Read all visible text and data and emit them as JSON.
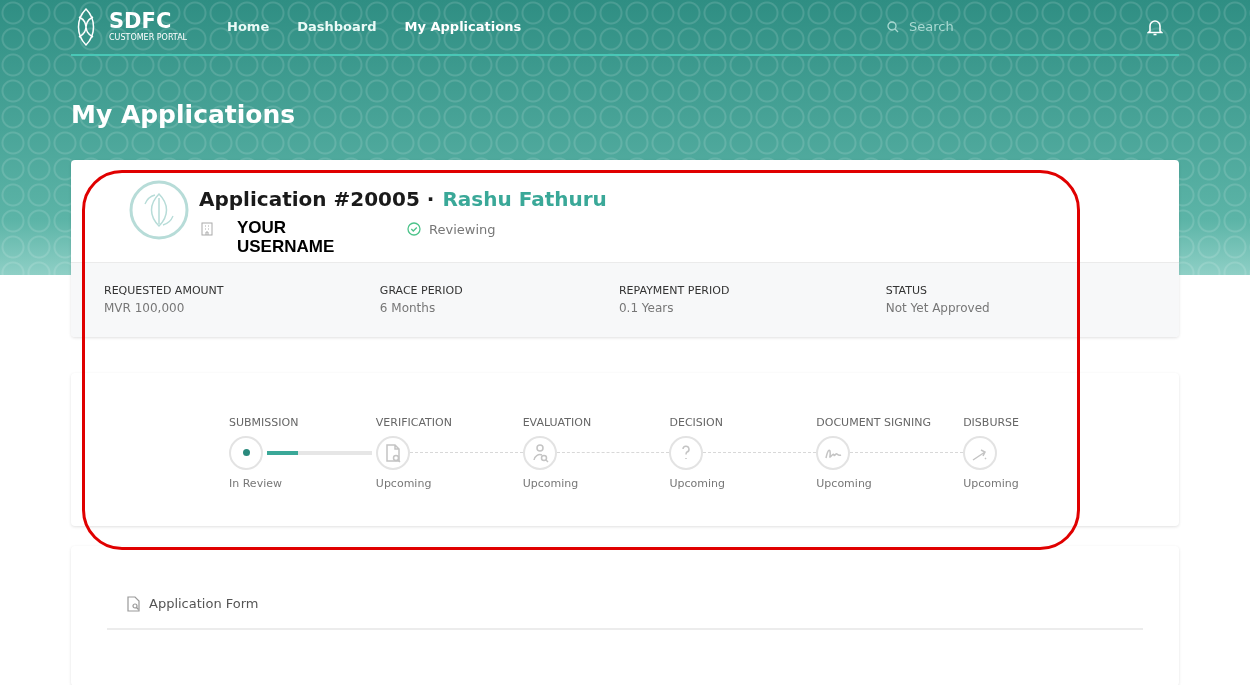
{
  "brand": {
    "name": "SDFC",
    "tagline": "CUSTOMER PORTAL"
  },
  "nav": [
    {
      "label": "Home",
      "selected": false
    },
    {
      "label": "Dashboard",
      "selected": false
    },
    {
      "label": "My Applications",
      "selected": true
    }
  ],
  "search": {
    "placeholder": "Search"
  },
  "page_title": "My Applications",
  "application": {
    "title": "Application #20005 ·",
    "name": "Rashu Fathuru",
    "username": "YOUR USERNAME",
    "status": "Reviewing"
  },
  "stats": [
    {
      "label": "REQUESTED AMOUNT",
      "value": "MVR 100,000"
    },
    {
      "label": "GRACE PERIOD",
      "value": "6 Months"
    },
    {
      "label": "REPAYMENT PERIOD",
      "value": "0.1 Years"
    },
    {
      "label": "STATUS",
      "value": "Not Yet Approved"
    }
  ],
  "steps": [
    {
      "label": "SUBMISSION",
      "status": "In Review",
      "kind": "current",
      "level": 0.3
    },
    {
      "label": "VERIFICATION",
      "status": "Upcoming",
      "kind": "document"
    },
    {
      "label": "EVALUATION",
      "status": "Upcoming",
      "kind": "person"
    },
    {
      "label": "DECISION",
      "status": "Upcoming",
      "kind": "question"
    },
    {
      "label": "DOCUMENT SIGNING",
      "status": "Upcoming",
      "kind": "signature"
    },
    {
      "label": "DISBURSE",
      "status": "Upcoming",
      "kind": "disburse"
    }
  ],
  "tabs": [
    {
      "label": "Application Form",
      "selected": true
    }
  ],
  "highlight": {
    "on": true
  }
}
